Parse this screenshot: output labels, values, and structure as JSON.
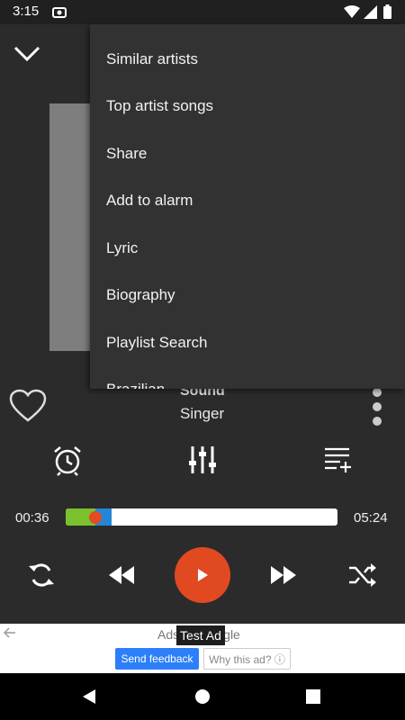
{
  "status": {
    "time": "3:15"
  },
  "menu": {
    "items": [
      "Similar artists",
      "Top artist songs",
      "Share",
      "Add to alarm",
      "Lyric",
      "Biography",
      "Playlist Search",
      "Brazilian"
    ]
  },
  "song": {
    "title": "Sound",
    "artist": "Singer"
  },
  "progress": {
    "elapsed": "00:36",
    "total": "05:24",
    "played_fraction": 0.11,
    "buffered_fraction": 0.17
  },
  "ad": {
    "label": "Ads by Google",
    "tooltip": "Test Ad",
    "send_feedback": "Send feedback",
    "why_this_ad": "Why this ad? ⓘ"
  },
  "colors": {
    "accent": "#e14a21",
    "progress_green": "#7ac12d",
    "progress_blue": "#2486d6"
  },
  "icons": [
    "chevron-down-icon",
    "heart-icon",
    "more-vert-icon",
    "alarm-icon",
    "equalizer-icon",
    "playlist-add-icon",
    "repeat-icon",
    "rewind-icon",
    "play-icon",
    "fast-forward-icon",
    "shuffle-icon",
    "back-arrow-icon",
    "nav-back-icon",
    "nav-home-icon",
    "nav-recents-icon"
  ]
}
